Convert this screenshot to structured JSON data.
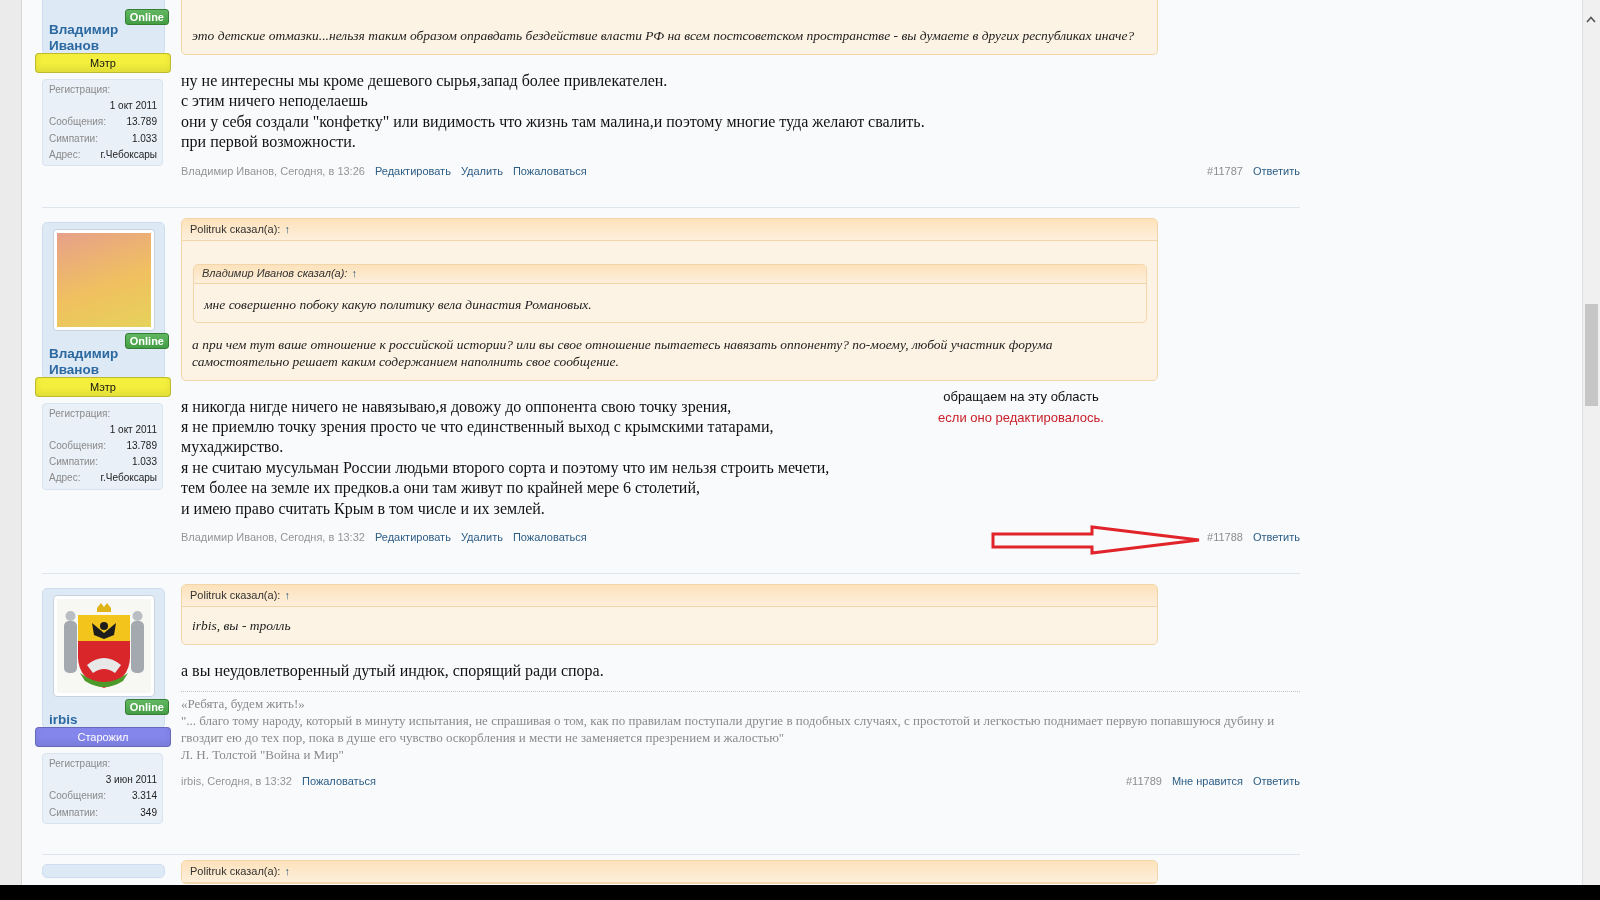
{
  "posts": [
    {
      "user": {
        "status": "Online",
        "name": "Владимир Иванов",
        "rank": {
          "label": "Мэтр",
          "color": "#f3ef3c"
        },
        "info": [
          {
            "kind": "stacked",
            "label": "Регистрация:",
            "value": "1 окт 2011"
          },
          {
            "kind": "inline",
            "label": "Сообщения:",
            "value": "13.789"
          },
          {
            "kind": "inline",
            "label": "Симпатии:",
            "value": "1.033"
          },
          {
            "kind": "inline",
            "label": "Адрес:",
            "value": "г.Чебоксары"
          }
        ]
      },
      "quote": {
        "text": "это детские отмазки...нельзя таким образом оправдать бездействие власти РФ на всем постсоветском пространстве - вы думаете в других республиках иначе?"
      },
      "message": "ну не интересны мы кроме дешевого сырья,запад более привлекателен.\nс этим ничего неподелаешь\nони у себя создали \"конфетку\" или видимость что жизнь там малина,и поэтому многие туда желают свалить.\nпри первой возможности.",
      "footer": {
        "meta": "Владимир Иванов, Сегодня, в 13:26",
        "links": [
          "Редактировать",
          "Удалить",
          "Пожаловаться"
        ],
        "number": "#11787",
        "actions": [
          "Ответить"
        ],
        "marked": false
      }
    },
    {
      "user": {
        "avatar": {
          "kind": "cartoon"
        },
        "status": "Online",
        "name": "Владимир Иванов",
        "rank": {
          "label": "Мэтр",
          "color": "#f3ef3c"
        },
        "info": [
          {
            "kind": "stacked",
            "label": "Регистрация:",
            "value": "1 окт 2011"
          },
          {
            "kind": "inline",
            "label": "Сообщения:",
            "value": "13.789"
          },
          {
            "kind": "inline",
            "label": "Симпатии:",
            "value": "1.033"
          },
          {
            "kind": "inline",
            "label": "Адрес:",
            "value": "г.Чебоксары"
          }
        ]
      },
      "quote": {
        "header": "Politruk сказал(а):",
        "jump": "↑",
        "quote": {
          "header": "Владимир Иванов сказал(а):",
          "jump": "↑",
          "text": "мне совершенно побоку какую политику вела династия Романовых."
        },
        "text": "а при чем тут ваше отношение к российской истории? или вы свое отношение пытаетесь навязать оппоненту? по-моему, любой участник форума самостоятельно решает каким содержанием наполнить свое сообщение."
      },
      "message": "я никогда нигде ничего не навязываю,я довожу до оппонента свою точку зрения,\nя не приемлю точку зрения просто че что единственный выход с крымскими татарами,\nмухаджирство.\nя не считаю мусульман России людьми второго сорта и поэтому что им нельзя строить мечети,\nтем более на земле их предков.а они там живут по крайней мере 6 столетий,\nи имею право считать Крым в том числе и их землей.",
      "annotation": [
        {
          "text": "обращаем на эту область",
          "color": "#111111"
        },
        {
          "text": "если оно редактировалось.",
          "color": "#c8202a"
        }
      ],
      "footer": {
        "meta": "Владимир Иванов, Сегодня, в 13:32",
        "links": [
          "Редактировать",
          "Удалить",
          "Пожаловаться"
        ],
        "number": "#11788",
        "actions": [
          "Ответить"
        ],
        "marked": true
      }
    },
    {
      "user": {
        "avatar": {
          "kind": "emblem"
        },
        "status": "Online",
        "name": "irbis",
        "rank": {
          "label": "Старожил",
          "color": "#8486ec"
        },
        "info": [
          {
            "kind": "stacked",
            "label": "Регистрация:",
            "value": "3 июн 2011"
          },
          {
            "kind": "inline",
            "label": "Сообщения:",
            "value": "3.314"
          },
          {
            "kind": "inline",
            "label": "Симпатии:",
            "value": "349"
          }
        ]
      },
      "quote": {
        "header": "Politruk сказал(а):",
        "jump": "↑",
        "text": "irbis, вы - тролль"
      },
      "message": "а вы неудовлетворенный дутый индюк, спорящий ради спора.",
      "signature": "«Ребята, будем жить!»\n\"... благо тому народу, который в минуту испытания, не спрашивая о том, как по правилам поступали другие в подобных случаях, с простотой и легкостью поднимает первую попавшуюся дубину и гвоздит ею до тех пор, пока в душе его чувство оскорбления и мести не заменяется презрением и жалостью\"\nЛ. Н. Толстой \"Война и Мир\"",
      "footer": {
        "meta": "irbis, Сегодня, в 13:32",
        "links": [
          "Пожаловаться"
        ],
        "number": "#11789",
        "actions": [
          "Мне нравится",
          "Ответить"
        ],
        "marked": false
      }
    },
    {
      "quote": {
        "header": "Politruk сказал(а):",
        "jump": "↑"
      }
    }
  ]
}
